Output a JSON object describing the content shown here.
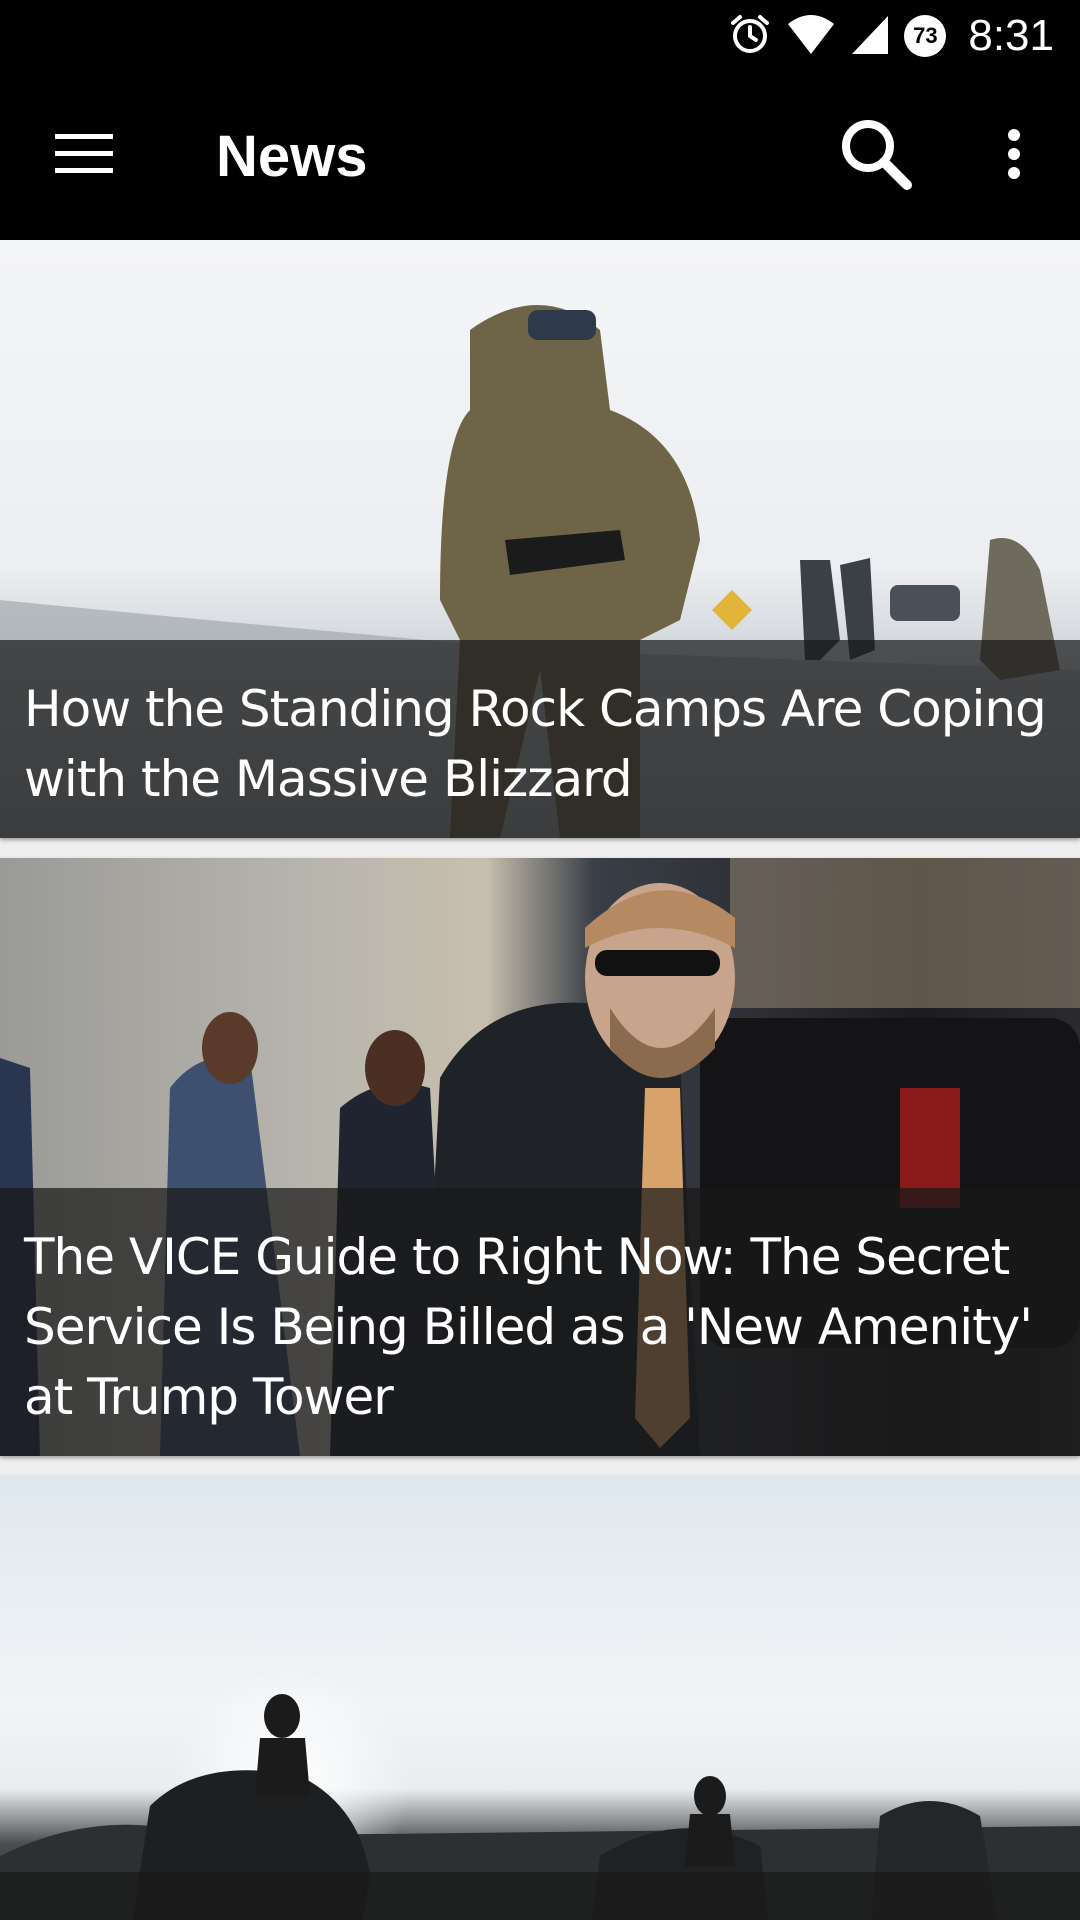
{
  "status_bar": {
    "time": "8:31",
    "battery_level": "73",
    "icons": [
      "alarm-icon",
      "wifi-icon",
      "cell-signal-icon",
      "battery-icon"
    ]
  },
  "app_bar": {
    "title": "News",
    "menu_icon": "menu-icon",
    "search_icon": "search-icon",
    "overflow_icon": "more-vert-icon"
  },
  "articles": [
    {
      "title": "How the Standing Rock Camps Are Coping with the Massive Blizzard"
    },
    {
      "title": "The VICE Guide to Right Now: The Secret Service Is Being Billed as a 'New Amenity' at Trump Tower"
    },
    {
      "title": ""
    }
  ],
  "colors": {
    "app_bar_bg": "#000000",
    "caption_overlay": "#191919",
    "text": "#ffffff"
  }
}
